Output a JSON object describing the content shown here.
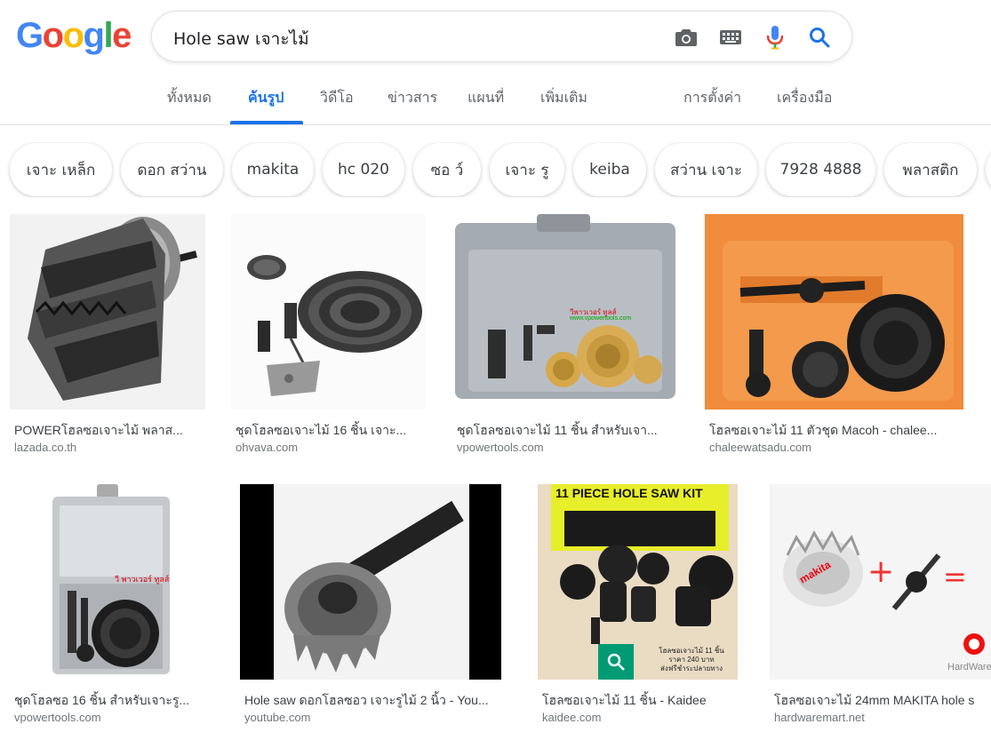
{
  "logo": {
    "letters": [
      "G",
      "o",
      "o",
      "g",
      "l",
      "e"
    ],
    "colors": [
      "#4285F4",
      "#EA4335",
      "#FBBC05",
      "#4285F4",
      "#34A853",
      "#EA4335"
    ]
  },
  "search": {
    "query": "Hole saw เจาะไม้"
  },
  "icons": {
    "camera": "camera-icon",
    "keyboard": "keyboard-icon",
    "mic": "mic-icon",
    "search": "search-icon"
  },
  "colors": {
    "accent": "#1a73e8",
    "text": "#202124",
    "muted": "#5f6368",
    "source": "#70757a"
  },
  "tabs": [
    {
      "label": "ทั้งหมด"
    },
    {
      "label": "ค้นรูป",
      "active": true
    },
    {
      "label": "วิดีโอ"
    },
    {
      "label": "ข่าวสาร"
    },
    {
      "label": "แผนที่"
    },
    {
      "label": "เพิ่มเติม"
    },
    {
      "label": "การตั้งค่า"
    },
    {
      "label": "เครื่องมือ"
    }
  ],
  "chips": [
    "เจาะ เหล็ก",
    "ดอก สว่าน",
    "makita",
    "hc 020",
    "ซอ ว์",
    "เจาะ รู",
    "keiba",
    "สว่าน เจาะ",
    "7928 4888",
    "พลาสติก"
  ],
  "results": [
    {
      "caption": "POWERโฮลซอเจาะไม้ พลาส...",
      "source": "lazada.co.th"
    },
    {
      "caption": "ชุดโฮลซอเจาะไม้ 16 ชิ้น เจาะ...",
      "source": "ohvava.com"
    },
    {
      "caption": "ชุดโฮลซอเจาะไม้ 11 ชิ้น สำหรับเจา...",
      "source": "vpowertools.com",
      "overlay": [
        "วีพาวเวอร์ ทูลส์",
        "www.vpowertools.com"
      ]
    },
    {
      "caption": "โฮลซอเจาะไม้ 11 ตัวชุด Macoh - chalee...",
      "source": "chaleewatsadu.com"
    },
    {
      "caption": "ชุดโฮลซอ 16 ชิ้น สำหรับเจาะรู...",
      "source": "vpowertools.com",
      "overlay": [
        "วี พาวเวอร์ ทูลส์"
      ]
    },
    {
      "caption": "Hole saw ดอกโฮลซอว เจาะรูไม้ 2 นิ้ว - You...",
      "source": "youtube.com"
    },
    {
      "caption": "โฮลซอเจาะไม้ 11 ชิ้น - Kaidee",
      "source": "kaidee.com",
      "overlay": [
        "11 PIECE HOLE SAW KIT",
        "โฮลซอเจาะไม้ 11 ชิ้น",
        "ราคา 240 บาท",
        "ส่งฟรีชำระปลายทาง"
      ]
    },
    {
      "caption": "โฮลซอเจาะไม้ 24mm MAKITA hole s",
      "source": "hardwaremart.net",
      "overlay": [
        "makita",
        "HardWareMart"
      ]
    }
  ]
}
